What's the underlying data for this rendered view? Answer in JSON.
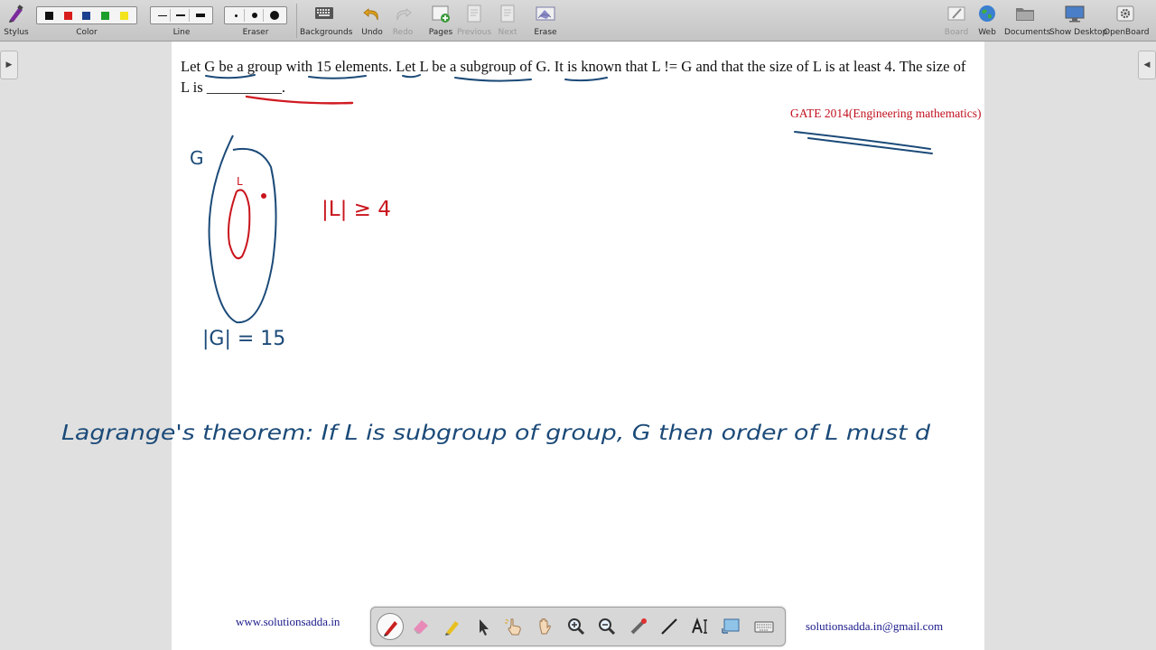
{
  "toolbar": {
    "stylus_label": "Stylus",
    "color_label": "Color",
    "line_label": "Line",
    "eraser_label": "Eraser",
    "backgrounds_label": "Backgrounds",
    "undo_label": "Undo",
    "redo_label": "Redo",
    "pages_label": "Pages",
    "previous_label": "Previous",
    "next_label": "Next",
    "erase_label": "Erase",
    "board_label": "Board",
    "web_label": "Web",
    "documents_label": "Documents",
    "show_desktop_label": "Show Desktop",
    "openboard_label": "OpenBoard",
    "colors": [
      "#111111",
      "#d81c1c",
      "#1d3f8f",
      "#1e9e2a",
      "#f2e31c"
    ]
  },
  "question": {
    "part1": "Let ",
    "g1": "G be a group",
    "part2": " ",
    "with": "with 15 elements",
    "part3": ". Let ",
    "l1": "L be a subgroup of G",
    "part4": ". It is known that L != G and that the size of L is at least 4. ",
    "size": "The size of L is",
    "part5": " __________."
  },
  "gate_text": "GATE 2014(Engineering mathematics)",
  "handwriting": {
    "g_label": "G",
    "l_label": "L",
    "l_size": "|L| ≥ 4",
    "g_size": "|G| = 15",
    "lagrange": "Lagrange's theorem:   If L is subgroup of group, G   then order of L must d"
  },
  "footer": {
    "website": "www.solutionsadda.in",
    "email": "solutionsadda.in@gmail.com"
  },
  "palette_tools": [
    "pen-icon",
    "eraser-icon",
    "marker-icon",
    "selector-icon",
    "interact-icon",
    "hand-icon",
    "zoom-in-icon",
    "zoom-out-icon",
    "laser-icon",
    "line-icon",
    "text-icon",
    "capture-icon",
    "keyboard-icon"
  ]
}
